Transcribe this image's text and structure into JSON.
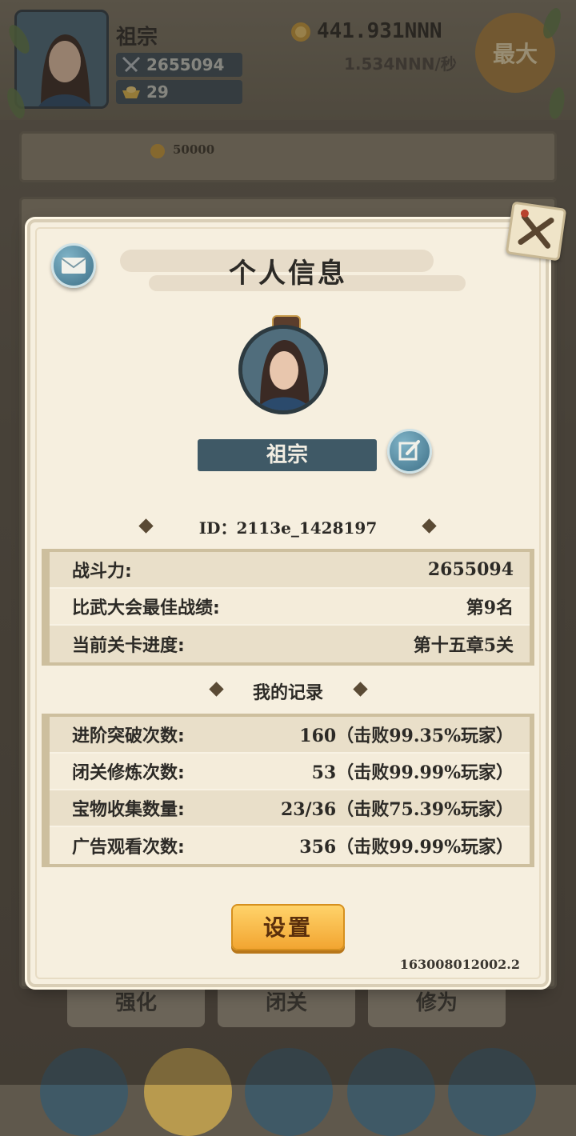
{
  "background": {
    "player_name": "祖宗",
    "power": "2655094",
    "ingots": "29",
    "gold": "441.931NNN",
    "gold_rate": "1.534NNN/秒",
    "max_button": "最大",
    "upgrade_cost": "50000",
    "bottom_tabs": [
      "强化",
      "闭关",
      "修为"
    ]
  },
  "dialog": {
    "title": "个人信息",
    "name": "祖宗",
    "id_line": "ID：2113e_1428197",
    "stats": [
      {
        "label": "战斗力:",
        "value": "2655094"
      },
      {
        "label": "比武大会最佳战绩:",
        "value": "第9名"
      },
      {
        "label": "当前关卡进度:",
        "value": "第十五章5关"
      }
    ],
    "records_title": "我的记录",
    "records": [
      {
        "label": "进阶突破次数:",
        "value": "160（击败99.35%玩家）"
      },
      {
        "label": "闭关修炼次数:",
        "value": "53（击败99.99%玩家）"
      },
      {
        "label": "宝物收集数量:",
        "value": "23/36（击败75.39%玩家）"
      },
      {
        "label": "广告观看次数:",
        "value": "356（击败99.99%玩家）"
      }
    ],
    "settings_button": "设置",
    "version": "163008012002.2"
  },
  "icons": {
    "mail": "mail-icon",
    "close": "close-icon",
    "edit": "edit-icon",
    "sword": "crossed-swords-icon",
    "ingot": "gold-ingot-icon",
    "coin": "coin-icon"
  },
  "colors": {
    "panel": "#f6efdf",
    "name_plate": "#3f5966",
    "settings_button": "#f2a531",
    "row_alt": "#e9dfc9"
  }
}
